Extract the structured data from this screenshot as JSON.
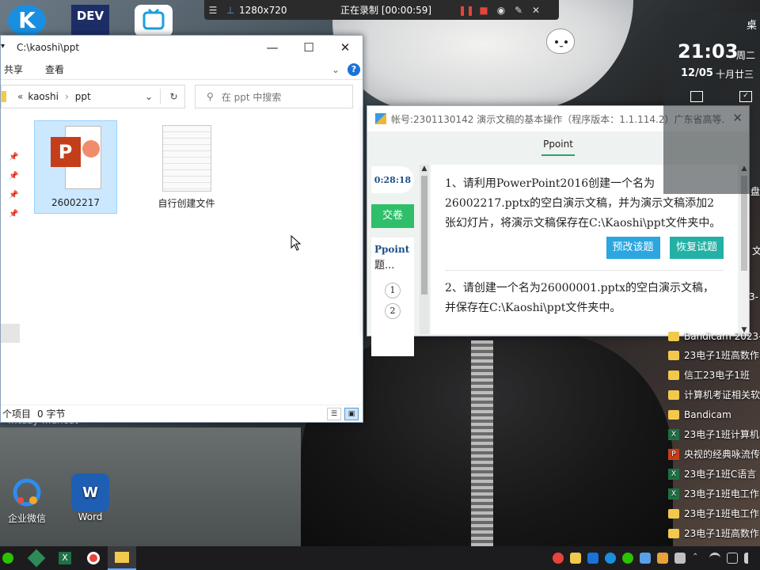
{
  "recorder": {
    "resolution": "1280x720",
    "status": "正在录制 [00:00:59]"
  },
  "desktop_icons": [
    {
      "label": "企业微信"
    },
    {
      "label": "Word"
    }
  ],
  "desktop_fragment_text": "…tuay    …uncut",
  "explorer": {
    "title": "C:\\kaoshi\\ppt",
    "ribbon": [
      "共享",
      "查看"
    ],
    "breadcrumb": {
      "prefix": "«",
      "parts": [
        "kaoshi",
        "ppt"
      ]
    },
    "search_placeholder": "在 ppt 中搜索",
    "files": [
      {
        "name": "26002217",
        "type": "pptx",
        "selected": true
      },
      {
        "name": "自行创建文件",
        "type": "blank",
        "selected": false
      }
    ],
    "status": {
      "count": "个项目",
      "size": "0 字节"
    }
  },
  "exam": {
    "title": "帐号:2301130142  演示文稿的基本操作（程序版本：1.1.114.2）广东省高等...",
    "tab": "Ppoint",
    "timer": "0:28:18",
    "submit_label": "交卷",
    "list_header": "Ppoint",
    "list_subheader": "题...",
    "question_numbers": [
      "1",
      "2"
    ],
    "questions": [
      {
        "text": "1、请利用PowerPoint2016创建一个名为26002217.pptx的空白演示文稿，并为演示文稿添加2张幻灯片，将演示文稿保存在C:\\Kaoshi\\ppt文件夹中。"
      },
      {
        "text": "2、请创建一个名为26000001.pptx的空白演示文稿，并保存在C:\\Kaoshi\\ppt文件夹中。"
      }
    ],
    "btn_modify": "预改该题",
    "btn_restore": "恢复试题"
  },
  "widget": {
    "label_top": "桌",
    "time": "21:03",
    "weekday": "周二",
    "date": "12/05",
    "lunar": "十月廿三"
  },
  "side_list": [
    {
      "icon": "folder",
      "label": "Bandicam 2023-"
    },
    {
      "icon": "folder",
      "label": "23电子1班高数作"
    },
    {
      "icon": "folder",
      "label": "信工23电子1班"
    },
    {
      "icon": "folder",
      "label": "计算机考证相关软"
    },
    {
      "icon": "folder",
      "label": "Bandicam"
    },
    {
      "icon": "xls",
      "label": "23电子1班计算机"
    },
    {
      "icon": "ppt",
      "label": "央视的经典咏流传"
    },
    {
      "icon": "xls",
      "label": "23电子1班C语言"
    },
    {
      "icon": "xls",
      "label": "23电子1班电工作"
    },
    {
      "icon": "folder",
      "label": "23电子1班电工作"
    },
    {
      "icon": "folder",
      "label": "23电子1班高数作"
    }
  ],
  "side_fragments": {
    "a": "3-",
    "b": "文",
    "c": "盘"
  },
  "colors": {
    "accent_green": "#2fbf6a",
    "teal_button": "#23b0a5",
    "blue_button": "#2ba6e0",
    "selection": "#cce8ff"
  }
}
